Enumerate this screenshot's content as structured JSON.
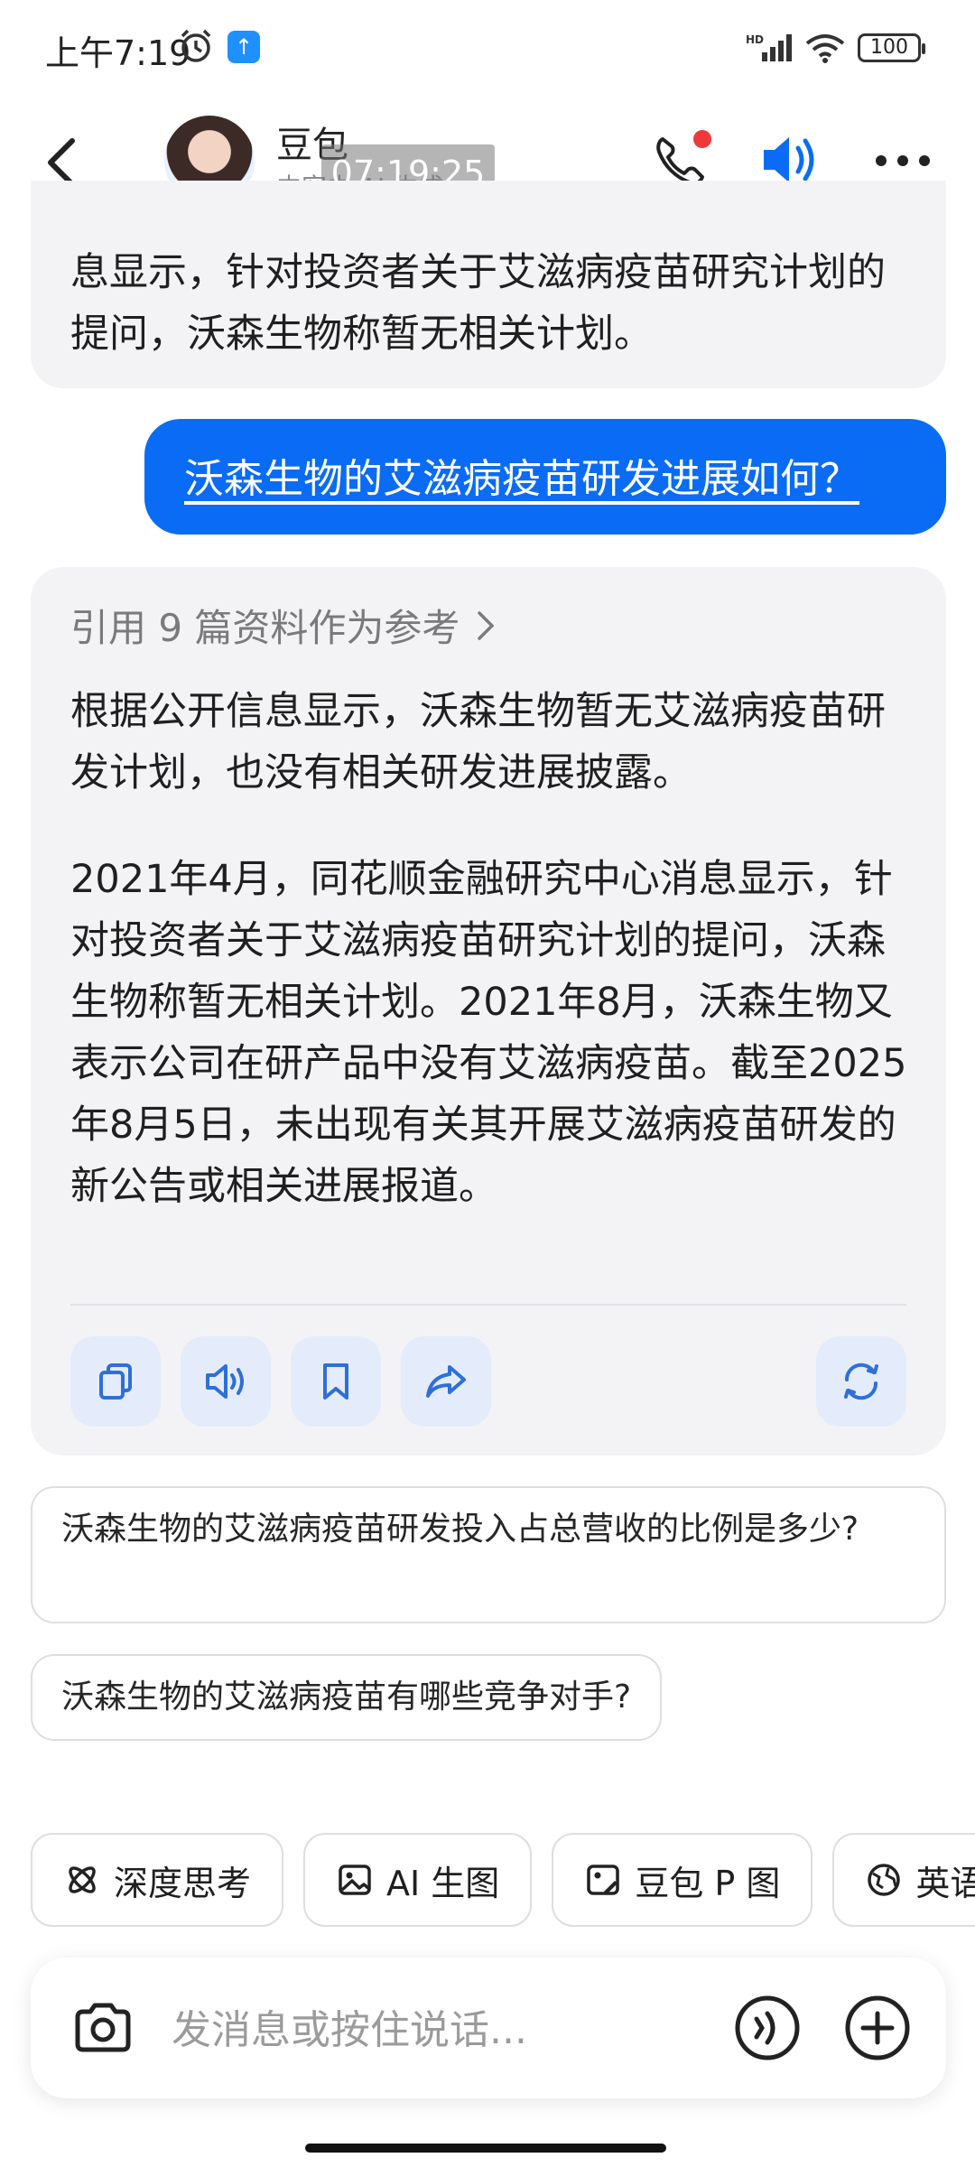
{
  "status_bar": {
    "time": "上午7:19",
    "battery": "100",
    "network": "HD"
  },
  "header": {
    "title": "豆包",
    "subtitle": "内容由 AI 生成",
    "timestamp_overlay": "07:19:25"
  },
  "messages": {
    "ai_previous_tail": "息显示，针对投资者关于艾滋病疫苗研究计划的提问，沃森生物称暂无相关计划。",
    "user_question": "沃森生物的艾滋病疫苗研发进展如何？",
    "ai_reply": {
      "reference_label": "引用 9 篇资料作为参考",
      "paragraph_1": "根据公开信息显示，沃森生物暂无艾滋病疫苗研发计划，也没有相关研发进展披露。",
      "paragraph_2": "2021年4月，同花顺金融研究中心消息显示，针对投资者关于艾滋病疫苗研究计划的提问，沃森生物称暂无相关计划。2021年8月，沃森生物又表示公司在研产品中没有艾滋病疫苗。截至2025年8月5日，未出现有关其开展艾滋病疫苗研发的新公告或相关进展报道。"
    }
  },
  "suggestions": [
    "沃森生物的艾滋病疫苗研发投入占总营收的比例是多少?",
    "沃森生物的艾滋病疫苗有哪些竞争对手?"
  ],
  "tools": [
    {
      "label": "深度思考",
      "icon": "atom-icon"
    },
    {
      "label": "AI 生图",
      "icon": "image-icon"
    },
    {
      "label": "豆包 P 图",
      "icon": "photo-edit-icon"
    },
    {
      "label": "英语",
      "icon": "globe-icon"
    }
  ],
  "input": {
    "placeholder": "发消息或按住说话..."
  },
  "colors": {
    "accent": "#0a6cf5",
    "bubble_ai": "#f3f3f5",
    "notification_dot": "#f0383a"
  }
}
